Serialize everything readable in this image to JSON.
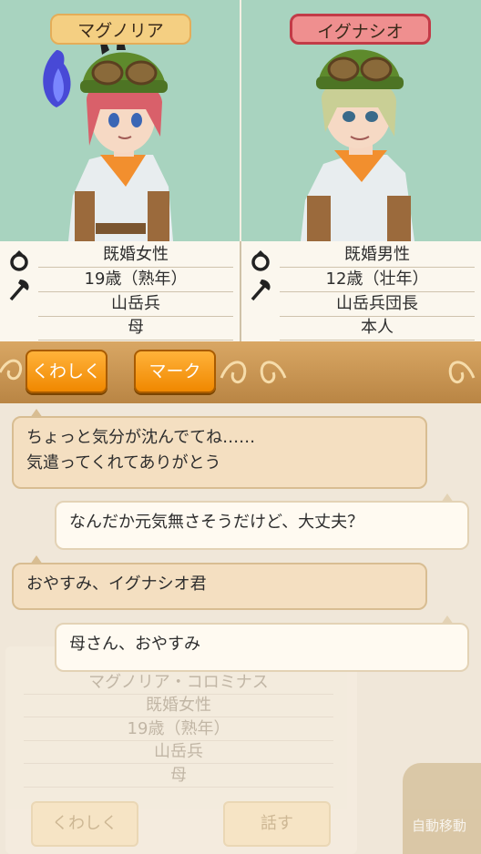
{
  "left_character": {
    "name": "マグノリア",
    "marital": "既婚女性",
    "age": "19歳（熟年）",
    "job": "山岳兵",
    "relation": "母"
  },
  "right_character": {
    "name": "イグナシオ",
    "marital": "既婚男性",
    "age": "12歳（壮年）",
    "job": "山岳兵団長",
    "relation": "本人"
  },
  "actions": {
    "details_label": "くわしく",
    "mark_label": "マーク"
  },
  "chat": {
    "messages": [
      {
        "from": "them",
        "line1": "ちょっと気分が沈んでてね……",
        "line2": "気遣ってくれてありがとう"
      },
      {
        "from": "me",
        "line1": "なんだか元気無さそうだけど、大丈夫？"
      },
      {
        "from": "them",
        "line1": "おやすみ、イグナシオ君"
      },
      {
        "from": "me",
        "line1": "母さん、おやすみ"
      }
    ]
  },
  "background_card": {
    "name": "マグノリア・コロミナス",
    "marital": "既婚女性",
    "age": "19歳（熟年）",
    "job": "山岳兵",
    "relation": "母",
    "details_label": "くわしく",
    "talk_label": "話す",
    "auto_move_label": "自動移動"
  },
  "colors": {
    "portrait_bg": "#a8d3bf",
    "action_button": "#f08800",
    "left_name_plate": "#f4cf82",
    "right_name_plate": "#ef8f8f"
  },
  "icons": [
    "ring-icon",
    "axe-icon",
    "tap-icon"
  ]
}
